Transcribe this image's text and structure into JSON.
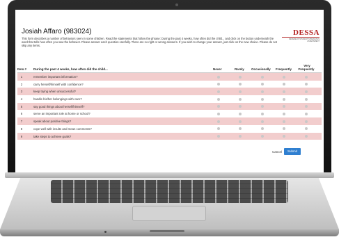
{
  "assessment": {
    "title": "Josiah Affaro (983024)",
    "description": "This form describes a number of behaviors seen in some children. Read the statements that follow the phrase:  During the past 4 weeks, how often did the child... and click on the button underneath the word that tells how often you saw the behavior.  Please answer each question carefully. There are no right or wrong answers.  If you wish to change your answer, just click on the new choice. Please do not skip any items."
  },
  "logo": {
    "text": "DESSA",
    "subtitle": "DEVEREUX STUDENT STRENGTHS ASSESSMENT",
    "color": "#b01c1c"
  },
  "table": {
    "headers": {
      "item": "Item #",
      "question": "During the past 4 weeks, how often did the child...",
      "never": "Never",
      "rarely": "Rarely",
      "occasionally": "Occasionally",
      "frequently": "Frequently",
      "very_frequently_1": "Very",
      "very_frequently_2": "Frequently"
    },
    "rows": [
      {
        "num": "1",
        "text": "remember important information?"
      },
      {
        "num": "2",
        "text": "carry herself/himself with confidence?"
      },
      {
        "num": "3",
        "text": "keep trying when unsuccessful?"
      },
      {
        "num": "4",
        "text": "handle his/her belongings with care?"
      },
      {
        "num": "5",
        "text": "say good things about herself/himself?"
      },
      {
        "num": "6",
        "text": "serve an important role at home or school?"
      },
      {
        "num": "7",
        "text": "speak about positive things?"
      },
      {
        "num": "8",
        "text": "cope well with insults and mean comments?"
      },
      {
        "num": "9",
        "text": "take steps to achieve goals?"
      }
    ],
    "row_color": "#f2cdcd"
  },
  "actions": {
    "cancel": "Cancel",
    "submit": "Submit",
    "submit_color": "#2f7fd0"
  }
}
